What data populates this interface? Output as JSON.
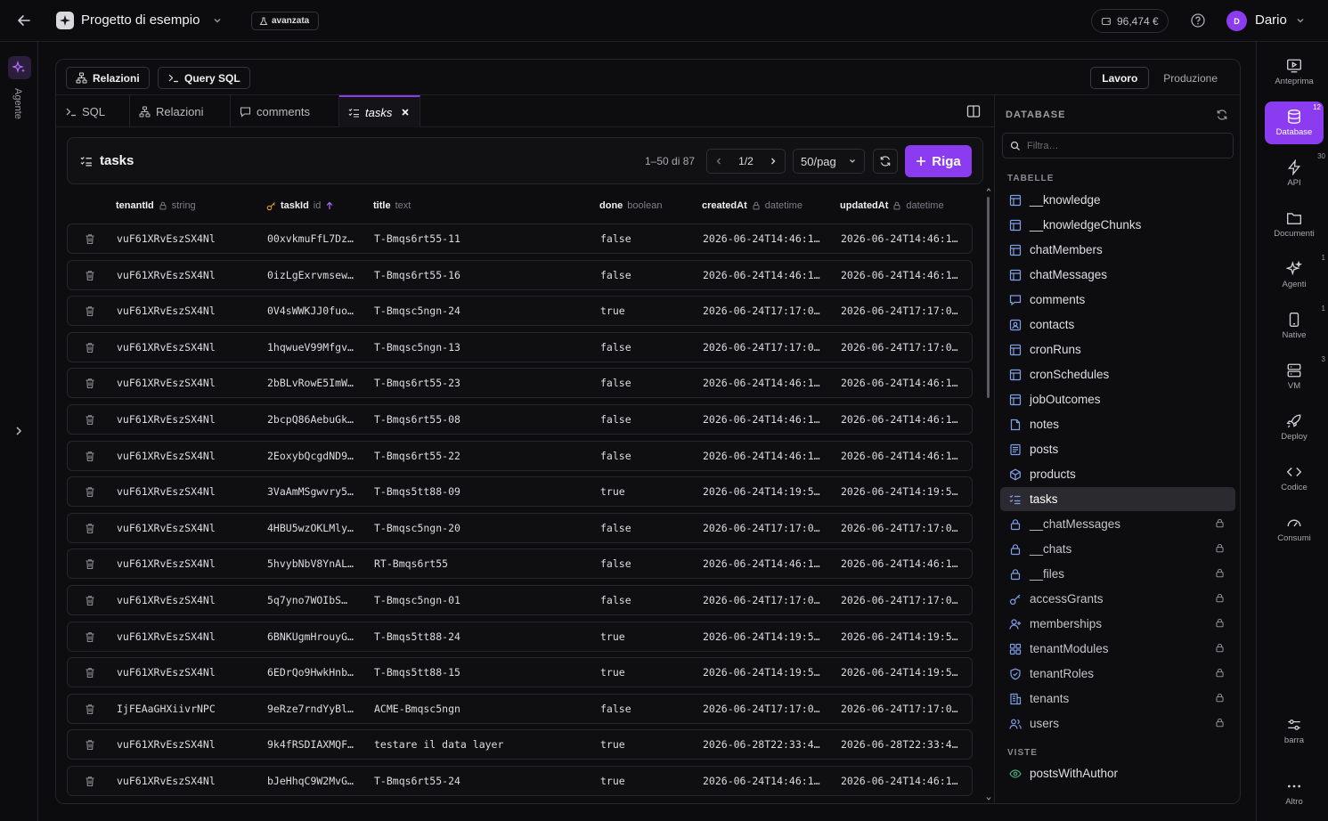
{
  "topbar": {
    "project_name": "Progetto di esempio",
    "mode_badge": "avanzata",
    "credits": "96,474 €",
    "user_initial": "D",
    "user_name": "Dario"
  },
  "left_rail": {
    "agent_label": "Agente"
  },
  "toolbar": {
    "relations_btn": "Relazioni",
    "sql_btn": "Query SQL",
    "env": [
      {
        "label": "Lavoro",
        "active": true
      },
      {
        "label": "Produzione",
        "active": false
      }
    ]
  },
  "tabs": [
    {
      "label": "SQL",
      "icon": "terminal-icon"
    },
    {
      "label": "Relazioni",
      "icon": "relations-icon"
    },
    {
      "label": "comments",
      "icon": "comment-icon"
    },
    {
      "label": "tasks",
      "icon": "checklist-icon",
      "active": true
    }
  ],
  "table_panel": {
    "title": "tasks",
    "range": "1–50 di 87",
    "page": "1/2",
    "per_page": "50/pag",
    "add_row": "Riga"
  },
  "columns": [
    {
      "name": "tenantId",
      "type": "string",
      "icon": "lock-icon"
    },
    {
      "name": "taskId",
      "type": "id",
      "icon": "key-icon",
      "sort": "asc"
    },
    {
      "name": "title",
      "type": "text"
    },
    {
      "name": "done",
      "type": "boolean"
    },
    {
      "name": "createdAt",
      "type": "datetime",
      "icon": "lock-icon"
    },
    {
      "name": "updatedAt",
      "type": "datetime",
      "icon": "lock-icon"
    }
  ],
  "rows": [
    [
      "vuF61XRvEszSX4Nl",
      "00xvkmuFfL7Dz…",
      "T-Bmqs6rt55-11",
      "false",
      "2026-06-24T14:46:1…",
      "2026-06-24T14:46:1…"
    ],
    [
      "vuF61XRvEszSX4Nl",
      "0izLgExrvmsew…",
      "T-Bmqs6rt55-16",
      "false",
      "2026-06-24T14:46:1…",
      "2026-06-24T14:46:1…"
    ],
    [
      "vuF61XRvEszSX4Nl",
      "0V4sWWKJJ0fuo…",
      "T-Bmqsc5ngn-24",
      "true",
      "2026-06-24T17:17:0…",
      "2026-06-24T17:17:0…"
    ],
    [
      "vuF61XRvEszSX4Nl",
      "1hqwueV99Mfgv…",
      "T-Bmqsc5ngn-13",
      "false",
      "2026-06-24T17:17:0…",
      "2026-06-24T17:17:0…"
    ],
    [
      "vuF61XRvEszSX4Nl",
      "2bBLvRowE5ImW…",
      "T-Bmqs6rt55-23",
      "false",
      "2026-06-24T14:46:1…",
      "2026-06-24T14:46:1…"
    ],
    [
      "vuF61XRvEszSX4Nl",
      "2bcpQ86AebuGk…",
      "T-Bmqs6rt55-08",
      "false",
      "2026-06-24T14:46:1…",
      "2026-06-24T14:46:1…"
    ],
    [
      "vuF61XRvEszSX4Nl",
      "2EoxybQcgdND9…",
      "T-Bmqs6rt55-22",
      "false",
      "2026-06-24T14:46:1…",
      "2026-06-24T14:46:1…"
    ],
    [
      "vuF61XRvEszSX4Nl",
      "3VaAmMSgwvry5…",
      "T-Bmqs5tt88-09",
      "true",
      "2026-06-24T14:19:5…",
      "2026-06-24T14:19:5…"
    ],
    [
      "vuF61XRvEszSX4Nl",
      "4HBU5wzOKLMly…",
      "T-Bmqsc5ngn-20",
      "false",
      "2026-06-24T17:17:0…",
      "2026-06-24T17:17:0…"
    ],
    [
      "vuF61XRvEszSX4Nl",
      "5hvybNbV8YnAL…",
      "RT-Bmqs6rt55",
      "false",
      "2026-06-24T14:46:1…",
      "2026-06-24T14:46:1…"
    ],
    [
      "vuF61XRvEszSX4Nl",
      "5q7yno7WOIbS…",
      "T-Bmqsc5ngn-01",
      "false",
      "2026-06-24T17:17:0…",
      "2026-06-24T17:17:0…"
    ],
    [
      "vuF61XRvEszSX4Nl",
      "6BNKUgmHrouyG…",
      "T-Bmqs5tt88-24",
      "true",
      "2026-06-24T14:19:5…",
      "2026-06-24T14:19:5…"
    ],
    [
      "vuF61XRvEszSX4Nl",
      "6EDrQo9HwkHnb…",
      "T-Bmqs5tt88-15",
      "true",
      "2026-06-24T14:19:5…",
      "2026-06-24T14:19:5…"
    ],
    [
      "IjFEAaGHXiivrNPC",
      "9eRze7rndYyBl…",
      "ACME-Bmqsc5ngn",
      "false",
      "2026-06-24T17:17:0…",
      "2026-06-24T17:17:0…"
    ],
    [
      "vuF61XRvEszSX4Nl",
      "9k4fRSDIAXMQF…",
      "testare il data layer",
      "true",
      "2026-06-28T22:33:4…",
      "2026-06-28T22:33:4…"
    ],
    [
      "vuF61XRvEszSX4Nl",
      "bJeHhqC9W2MvG…",
      "T-Bmqs6rt55-24",
      "true",
      "2026-06-24T14:46:1…",
      "2026-06-24T14:46:1…"
    ]
  ],
  "db_panel": {
    "title": "DATABASE",
    "filter_placeholder": "Filtra…",
    "tables_heading": "TABELLE",
    "tables": [
      {
        "name": "__knowledge",
        "icon": "table-icon"
      },
      {
        "name": "__knowledgeChunks",
        "icon": "table-icon"
      },
      {
        "name": "chatMembers",
        "icon": "table-icon"
      },
      {
        "name": "chatMessages",
        "icon": "table-icon"
      },
      {
        "name": "comments",
        "icon": "comment-icon"
      },
      {
        "name": "contacts",
        "icon": "contact-icon"
      },
      {
        "name": "cronRuns",
        "icon": "table-icon"
      },
      {
        "name": "cronSchedules",
        "icon": "table-icon"
      },
      {
        "name": "jobOutcomes",
        "icon": "table-icon"
      },
      {
        "name": "notes",
        "icon": "note-icon"
      },
      {
        "name": "posts",
        "icon": "post-icon"
      },
      {
        "name": "products",
        "icon": "package-icon"
      },
      {
        "name": "tasks",
        "icon": "checklist-icon",
        "active": true
      },
      {
        "name": "__chatMessages",
        "icon": "lock-icon",
        "locked": true
      },
      {
        "name": "__chats",
        "icon": "lock-icon",
        "locked": true
      },
      {
        "name": "__files",
        "icon": "lock-icon",
        "locked": true
      },
      {
        "name": "accessGrants",
        "icon": "key-icon",
        "locked": true
      },
      {
        "name": "memberships",
        "icon": "user-plus-icon",
        "locked": true
      },
      {
        "name": "tenantModules",
        "icon": "modules-icon",
        "locked": true
      },
      {
        "name": "tenantRoles",
        "icon": "shield-icon",
        "locked": true
      },
      {
        "name": "tenants",
        "icon": "building-icon",
        "locked": true
      },
      {
        "name": "users",
        "icon": "users-icon",
        "locked": true
      }
    ],
    "views_heading": "VISTE",
    "views": [
      {
        "name": "postsWithAuthor",
        "icon": "eye-icon"
      }
    ]
  },
  "right_rail": [
    {
      "label": "Anteprima",
      "icon": "preview-icon",
      "badge": ""
    },
    {
      "label": "Database",
      "icon": "database-icon",
      "badge": "12",
      "active": true
    },
    {
      "label": "API",
      "icon": "bolt-icon",
      "badge": "30"
    },
    {
      "label": "Documenti",
      "icon": "folder-icon",
      "badge": ""
    },
    {
      "label": "Agenti",
      "icon": "sparkle-icon",
      "badge": "1"
    },
    {
      "label": "Native",
      "icon": "phone-icon",
      "badge": "1"
    },
    {
      "label": "VM",
      "icon": "server-icon",
      "badge": "3"
    },
    {
      "label": "Deploy",
      "icon": "rocket-icon",
      "badge": ""
    },
    {
      "label": "Codice",
      "icon": "code-icon",
      "badge": ""
    },
    {
      "label": "Consumi",
      "icon": "gauge-icon",
      "badge": ""
    },
    {
      "label": "barra",
      "icon": "sliders-icon",
      "badge": ""
    },
    {
      "label": "Altro",
      "icon": "more-icon",
      "badge": ""
    }
  ],
  "colors": {
    "accent": "#8b3cf0",
    "bg": "#0c0c0e",
    "panel": "#111114",
    "border": "#26262b",
    "view_icon": "#4caf7a"
  }
}
